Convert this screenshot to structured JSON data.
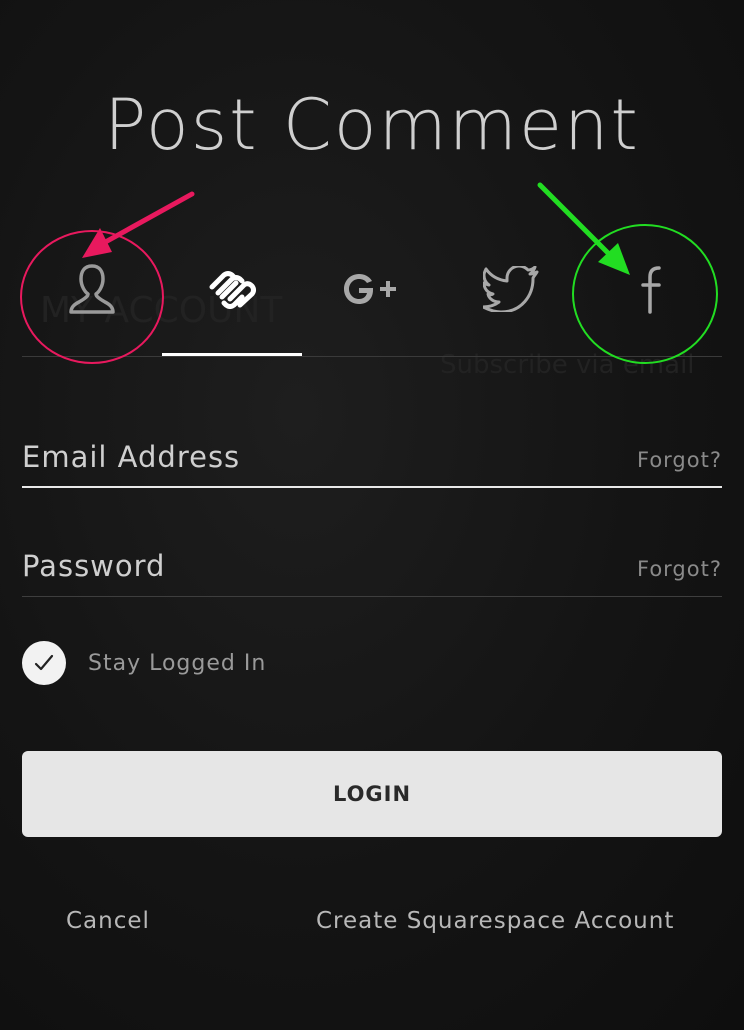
{
  "dialog": {
    "title": "Post Comment"
  },
  "tabs": [
    {
      "icon": "user-icon",
      "active": false
    },
    {
      "icon": "squarespace-icon",
      "active": true
    },
    {
      "icon": "google-plus-icon",
      "active": false
    },
    {
      "icon": "twitter-icon",
      "active": false
    },
    {
      "icon": "facebook-icon",
      "active": false
    }
  ],
  "form": {
    "email_label": "Email Address",
    "email_forgot": "Forgot?",
    "password_label": "Password",
    "password_forgot": "Forgot?",
    "stay_logged_in_label": "Stay Logged In",
    "stay_logged_in_checked": true,
    "login_label": "LOGIN"
  },
  "footer": {
    "cancel_label": "Cancel",
    "create_account_label": "Create Squarespace Account"
  },
  "annotations": {
    "left_color": "#e8195e",
    "right_color": "#22dd22"
  }
}
